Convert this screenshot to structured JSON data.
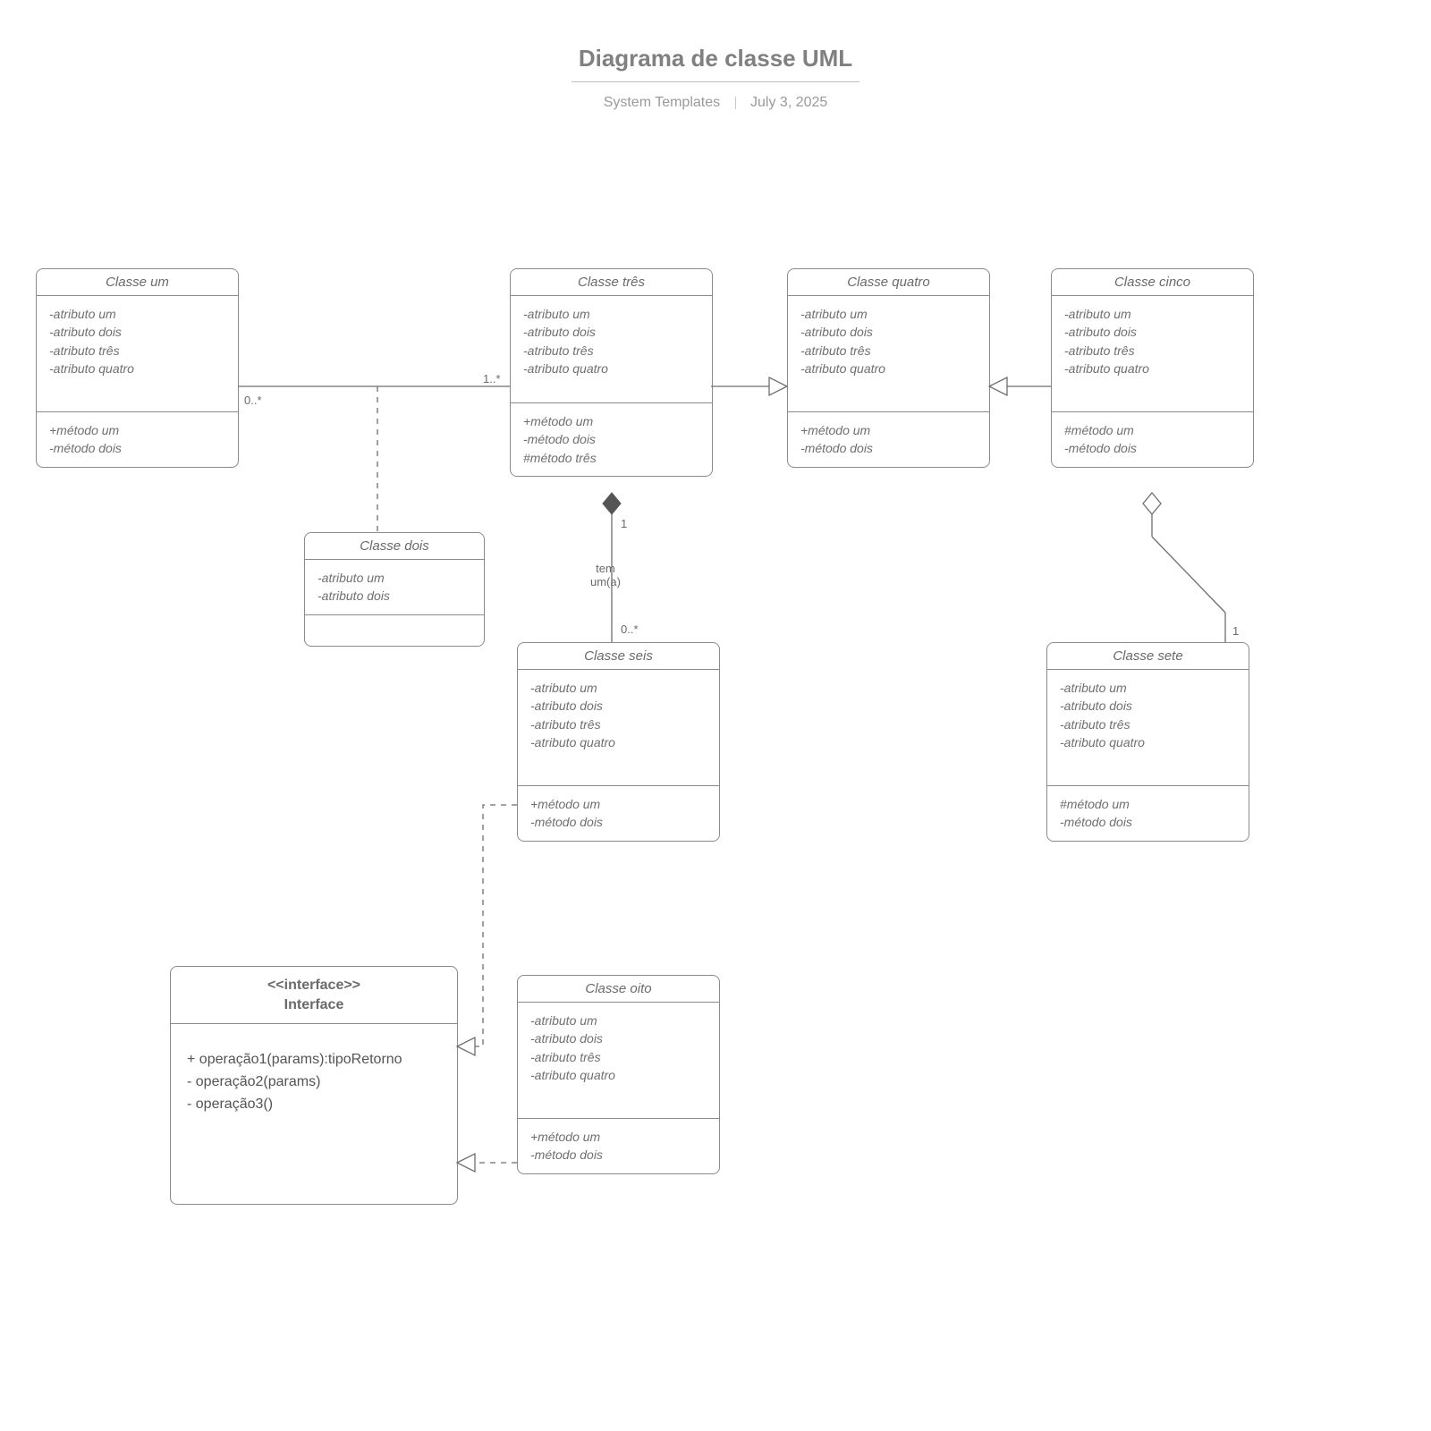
{
  "header": {
    "title": "Diagrama de classe UML",
    "author": "System Templates",
    "date": "July 3, 2025"
  },
  "classes": {
    "c1": {
      "name": "Classe um",
      "attrs": [
        "-atributo um",
        "-atributo dois",
        "-atributo três",
        "-atributo quatro"
      ],
      "methods": [
        "+método um",
        "-método dois"
      ]
    },
    "c2": {
      "name": "Classe dois",
      "attrs": [
        "-atributo um",
        "-atributo dois"
      ],
      "methods": []
    },
    "c3": {
      "name": "Classe três",
      "attrs": [
        "-atributo um",
        "-atributo dois",
        "-atributo três",
        "-atributo quatro"
      ],
      "methods": [
        "+método um",
        "-método dois",
        "#método três"
      ]
    },
    "c4": {
      "name": "Classe quatro",
      "attrs": [
        "-atributo um",
        "-atributo dois",
        "-atributo três",
        "-atributo quatro"
      ],
      "methods": [
        "+método um",
        "-método dois"
      ]
    },
    "c5": {
      "name": "Classe cinco",
      "attrs": [
        "-atributo um",
        "-atributo dois",
        "-atributo três",
        "-atributo quatro"
      ],
      "methods": [
        "#método um",
        "-método dois"
      ]
    },
    "c6": {
      "name": "Classe seis",
      "attrs": [
        "-atributo um",
        "-atributo dois",
        "-atributo três",
        "-atributo quatro"
      ],
      "methods": [
        "+método um",
        "-método dois"
      ]
    },
    "c7": {
      "name": "Classe sete",
      "attrs": [
        "-atributo um",
        "-atributo dois",
        "-atributo três",
        "-atributo quatro"
      ],
      "methods": [
        "#método um",
        "-método dois"
      ]
    },
    "c8": {
      "name": "Classe oito",
      "attrs": [
        "-atributo um",
        "-atributo dois",
        "-atributo três",
        "-atributo quatro"
      ],
      "methods": [
        "+método um",
        "-método dois"
      ]
    },
    "iface": {
      "stereotype": "<<interface>>",
      "name": "Interface",
      "ops": [
        "+ operação1(params):tipoRetorno",
        "- operação2(params)",
        "- operação3()"
      ]
    }
  },
  "labels": {
    "mult_0star_a": "0..*",
    "mult_1star": "1..*",
    "mult_1_a": "1",
    "mult_0star_b": "0..*",
    "assoc_name": "tem\num(a)",
    "mult_1_b": "1"
  }
}
